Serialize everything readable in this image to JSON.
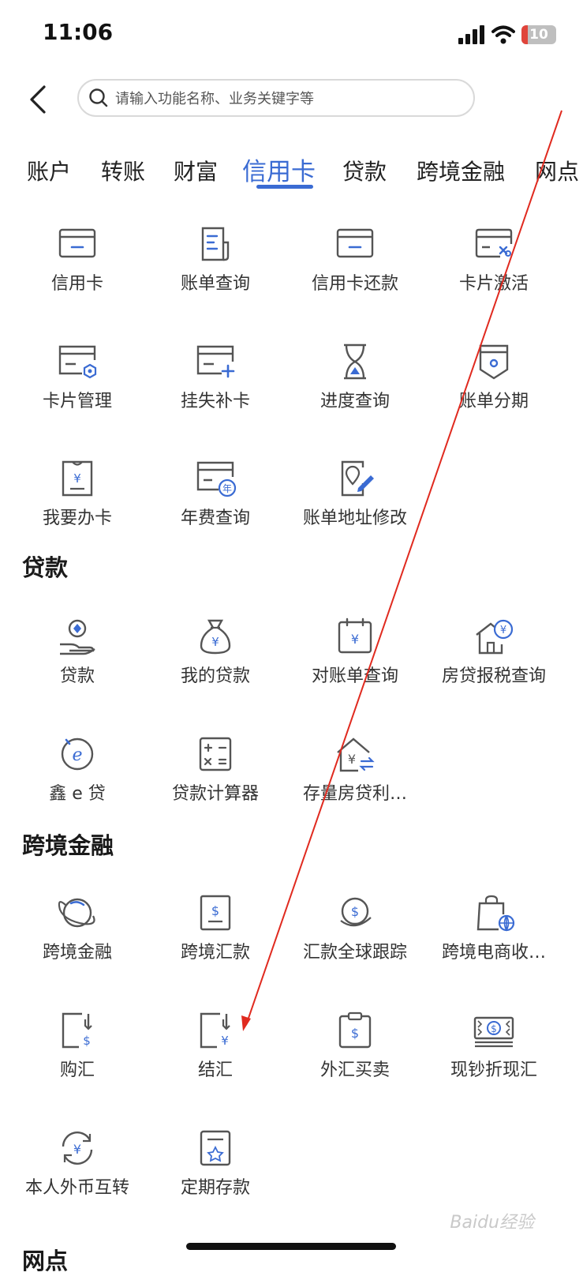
{
  "status": {
    "time": "11:06",
    "battery": "10"
  },
  "header": {
    "search_placeholder": "请输入功能名称、业务关键字等"
  },
  "tabs": [
    {
      "label": "账户"
    },
    {
      "label": "转账"
    },
    {
      "label": "财富"
    },
    {
      "label": "信用卡",
      "active": true
    },
    {
      "label": "贷款"
    },
    {
      "label": "跨境金融"
    },
    {
      "label": "网点"
    }
  ],
  "credit": {
    "items": [
      {
        "label": "信用卡",
        "icon": "credit-card-icon"
      },
      {
        "label": "账单查询",
        "icon": "bill-inquiry-icon"
      },
      {
        "label": "信用卡还款",
        "icon": "card-repay-icon"
      },
      {
        "label": "卡片激活",
        "icon": "card-activate-icon"
      },
      {
        "label": "卡片管理",
        "icon": "card-manage-icon"
      },
      {
        "label": "挂失补卡",
        "icon": "card-replace-icon"
      },
      {
        "label": "进度查询",
        "icon": "hourglass-icon"
      },
      {
        "label": "账单分期",
        "icon": "installment-icon"
      },
      {
        "label": "我要办卡",
        "icon": "apply-card-icon"
      },
      {
        "label": "年费查询",
        "icon": "annual-fee-icon"
      },
      {
        "label": "账单地址修改",
        "icon": "address-edit-icon"
      }
    ]
  },
  "loans": {
    "title": "贷款",
    "items": [
      {
        "label": "贷款",
        "icon": "loan-hand-icon"
      },
      {
        "label": "我的贷款",
        "icon": "money-bag-icon"
      },
      {
        "label": "对账单查询",
        "icon": "statement-calendar-icon"
      },
      {
        "label": "房贷报税查询",
        "icon": "house-tax-icon"
      },
      {
        "label": "鑫 e 贷",
        "icon": "e-loan-icon"
      },
      {
        "label": "贷款计算器",
        "icon": "calculator-icon"
      },
      {
        "label": "存量房贷利…",
        "icon": "house-rate-icon"
      }
    ]
  },
  "crossborder": {
    "title": "跨境金融",
    "items": [
      {
        "label": "跨境金融",
        "icon": "planet-icon"
      },
      {
        "label": "跨境汇款",
        "icon": "remit-doc-icon"
      },
      {
        "label": "汇款全球跟踪",
        "icon": "globe-dollar-icon"
      },
      {
        "label": "跨境电商收…",
        "icon": "shop-bag-globe-icon"
      },
      {
        "label": "购汇",
        "icon": "buy-fx-icon"
      },
      {
        "label": "结汇",
        "icon": "settle-fx-icon"
      },
      {
        "label": "外汇买卖",
        "icon": "fx-trade-icon"
      },
      {
        "label": "现钞折现汇",
        "icon": "cash-note-icon"
      },
      {
        "label": "本人外币互转",
        "icon": "currency-swap-icon"
      },
      {
        "label": "定期存款",
        "icon": "deposit-icon"
      }
    ]
  },
  "branch": {
    "title": "网点"
  },
  "watermark": "Baidu经验"
}
